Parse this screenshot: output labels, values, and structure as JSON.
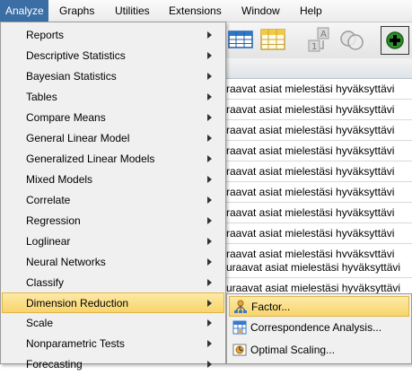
{
  "menubar": {
    "items": [
      "Analyze",
      "Graphs",
      "Utilities",
      "Extensions",
      "Window",
      "Help"
    ]
  },
  "analyze_menu": {
    "items": [
      {
        "label": "Reports"
      },
      {
        "label": "Descriptive Statistics"
      },
      {
        "label": "Bayesian Statistics"
      },
      {
        "label": "Tables"
      },
      {
        "label": "Compare Means"
      },
      {
        "label": "General Linear Model"
      },
      {
        "label": "Generalized Linear Models"
      },
      {
        "label": "Mixed Models"
      },
      {
        "label": "Correlate"
      },
      {
        "label": "Regression"
      },
      {
        "label": "Loglinear"
      },
      {
        "label": "Neural Networks"
      },
      {
        "label": "Classify"
      },
      {
        "label": "Dimension Reduction"
      },
      {
        "label": "Scale"
      },
      {
        "label": "Nonparametric Tests"
      },
      {
        "label": "Forecasting"
      }
    ],
    "highlighted": "Dimension Reduction"
  },
  "dimension_reduction_submenu": {
    "items": [
      {
        "label": "Factor...",
        "icon": "factor-icon"
      },
      {
        "label": "Correspondence Analysis...",
        "icon": "correspondence-icon"
      },
      {
        "label": "Optimal Scaling...",
        "icon": "optimal-scaling-icon"
      }
    ],
    "highlighted": "Factor..."
  },
  "data_rows": [
    "raavat asiat mielestäsi hyväksyttävi",
    "raavat asiat mielestäsi hyväksyttävi",
    "raavat asiat mielestäsi hyväksyttävi",
    "raavat asiat mielestäsi hyväksyttävi",
    "raavat asiat mielestäsi hyväksyttävi",
    "raavat asiat mielestäsi hyväksyttävi",
    "raavat asiat mielestäsi hyväksyttävi",
    "raavat asiat mielestäsi hyväksyttävi",
    "raavat asiat mielestäsi hyväksyttävi",
    "uraavat asiat mielestäsi hyväksyttävi",
    "uraavat asiat mielestäsi hyväksyttävi"
  ],
  "toolbar": {
    "icons": [
      "grid-table-icon",
      "pivot-table-icon",
      "value-labels-icon",
      "venn-icon",
      "add-variable-icon"
    ]
  },
  "colors": {
    "menu_active": "#3a6ea5",
    "highlight": "#f8d46b",
    "menu_background": "#f0f0f0"
  }
}
